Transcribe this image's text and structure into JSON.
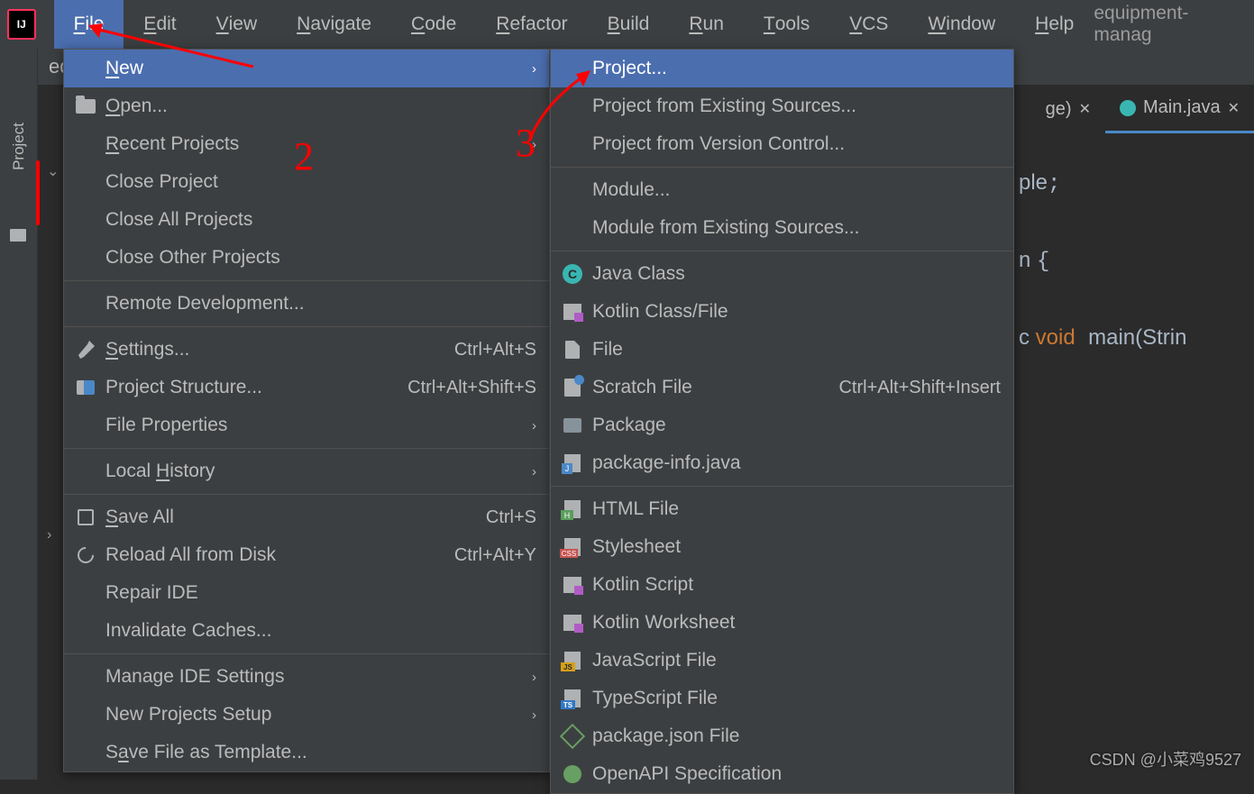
{
  "menubar": {
    "items": [
      "File",
      "Edit",
      "View",
      "Navigate",
      "Code",
      "Refactor",
      "Build",
      "Run",
      "Tools",
      "VCS",
      "Window",
      "Help"
    ],
    "project_name": "equipment-manag"
  },
  "sidebar": {
    "label": "Project"
  },
  "breadcrumb": "equi",
  "tabs": {
    "left_partial": "ge)",
    "active": "Main.java"
  },
  "code": {
    "l1": "ple",
    "l2": "n ",
    "l3": "c ",
    "kw_void": "void",
    "fn": "main",
    "paren": "(Strin"
  },
  "file_menu": [
    {
      "label": "New",
      "sel": true,
      "arrow": true,
      "ul": "N"
    },
    {
      "label": "Open...",
      "icon": "folder",
      "ul": "O"
    },
    {
      "label": "Recent Projects",
      "arrow": true,
      "ul": "R"
    },
    {
      "label": "Close Project"
    },
    {
      "label": "Close All Projects"
    },
    {
      "label": "Close Other Projects"
    },
    {
      "sep": true
    },
    {
      "label": "Remote Development..."
    },
    {
      "sep": true
    },
    {
      "label": "Settings...",
      "sc": "Ctrl+Alt+S",
      "icon": "wrench",
      "ul": "S"
    },
    {
      "label": "Project Structure...",
      "sc": "Ctrl+Alt+Shift+S",
      "icon": "struct"
    },
    {
      "label": "File Properties",
      "arrow": true
    },
    {
      "sep": true
    },
    {
      "label": "Local History",
      "arrow": true,
      "ul": "H"
    },
    {
      "sep": true
    },
    {
      "label": "Save All",
      "sc": "Ctrl+S",
      "icon": "save",
      "ul": "S"
    },
    {
      "label": "Reload All from Disk",
      "sc": "Ctrl+Alt+Y",
      "icon": "reload"
    },
    {
      "label": "Repair IDE"
    },
    {
      "label": "Invalidate Caches..."
    },
    {
      "sep": true
    },
    {
      "label": "Manage IDE Settings",
      "arrow": true
    },
    {
      "label": "New Projects Setup",
      "arrow": true
    },
    {
      "label": "Save File as Template...",
      "ul": "a"
    }
  ],
  "new_menu": [
    {
      "label": "Project...",
      "sel": true
    },
    {
      "label": "Project from Existing Sources..."
    },
    {
      "label": "Project from Version Control..."
    },
    {
      "sep": true
    },
    {
      "label": "Module..."
    },
    {
      "label": "Module from Existing Sources..."
    },
    {
      "sep": true
    },
    {
      "label": "Java Class",
      "icon": "c"
    },
    {
      "label": "Kotlin Class/File",
      "icon": "k"
    },
    {
      "label": "File",
      "icon": "file"
    },
    {
      "label": "Scratch File",
      "sc": "Ctrl+Alt+Shift+Insert",
      "icon": "scratch"
    },
    {
      "label": "Package",
      "icon": "pkg"
    },
    {
      "label": "package-info.java",
      "icon": "pinfo"
    },
    {
      "sep": true
    },
    {
      "label": "HTML File",
      "icon": "html"
    },
    {
      "label": "Stylesheet",
      "icon": "css"
    },
    {
      "label": "Kotlin Script",
      "icon": "k"
    },
    {
      "label": "Kotlin Worksheet",
      "icon": "k"
    },
    {
      "label": "JavaScript File",
      "icon": "js"
    },
    {
      "label": "TypeScript File",
      "icon": "ts"
    },
    {
      "label": "package.json File",
      "icon": "node"
    },
    {
      "label": "OpenAPI Specification",
      "icon": "swag"
    }
  ],
  "annotations": {
    "num2": "2",
    "num3": "3"
  },
  "watermark": "CSDN @小菜鸡9527"
}
